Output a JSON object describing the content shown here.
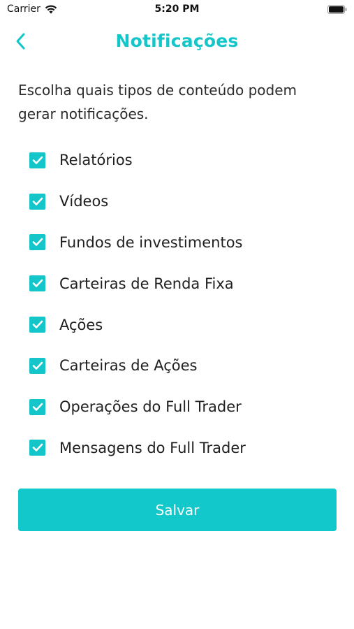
{
  "status_bar": {
    "carrier": "Carrier",
    "time": "5:20 PM",
    "wifi_icon": "wifi-icon",
    "battery_icon": "battery-icon"
  },
  "header": {
    "title": "Notificações",
    "back_icon": "chevron-left-icon"
  },
  "description": "Escolha quais tipos de conteúdo podem gerar notificações.",
  "options": [
    {
      "label": "Relatórios",
      "checked": true
    },
    {
      "label": "Vídeos",
      "checked": true
    },
    {
      "label": "Fundos de investimentos",
      "checked": true
    },
    {
      "label": "Carteiras de Renda Fixa",
      "checked": true
    },
    {
      "label": "Ações",
      "checked": true
    },
    {
      "label": "Carteiras de Ações",
      "checked": true
    },
    {
      "label": "Operações do Full Trader",
      "checked": true
    },
    {
      "label": "Mensagens do Full Trader",
      "checked": true
    }
  ],
  "save_button": {
    "label": "Salvar"
  },
  "colors": {
    "accent": "#14c5c9",
    "button": "#12c8ca",
    "text": "#1f1f1f",
    "background": "#ffffff"
  }
}
